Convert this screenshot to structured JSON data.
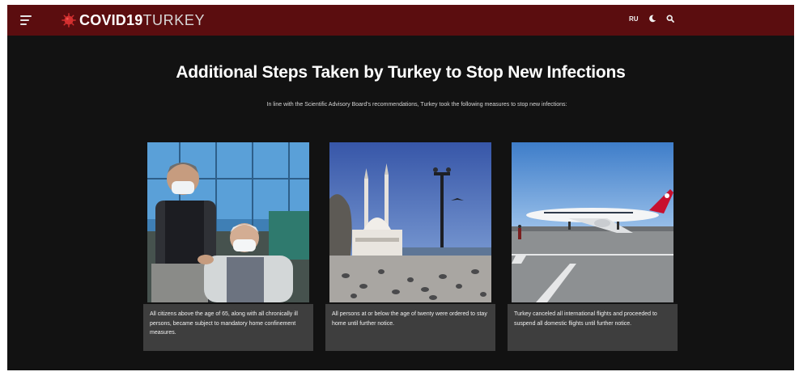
{
  "header": {
    "brand_strong": "COVID19",
    "brand_light": "TURKEY",
    "lang_label": "RU",
    "icons": [
      "hamburger-icon",
      "virus-icon",
      "moon-icon",
      "search-icon"
    ]
  },
  "main": {
    "title": "Additional Steps Taken by Turkey to Stop New Infections",
    "intro": "In line with the Scientific Advisory Board's recommendations, Turkey took the following measures to stop new infections:"
  },
  "cards": [
    {
      "caption": "All citizens above the age of 65, along with all chronically ill persons, became subject to mandatory home confinement measures."
    },
    {
      "caption": "All persons at or below the age of twenty were ordered to stay home until further notice."
    },
    {
      "caption": "Turkey canceled all international flights and proceeded to suspend all domestic flights until further notice."
    }
  ],
  "colors": {
    "navbar": "#5b0d0f",
    "page_background": "#121212",
    "caption_background": "#3e3e3e",
    "accent_red": "#d32f2f"
  }
}
